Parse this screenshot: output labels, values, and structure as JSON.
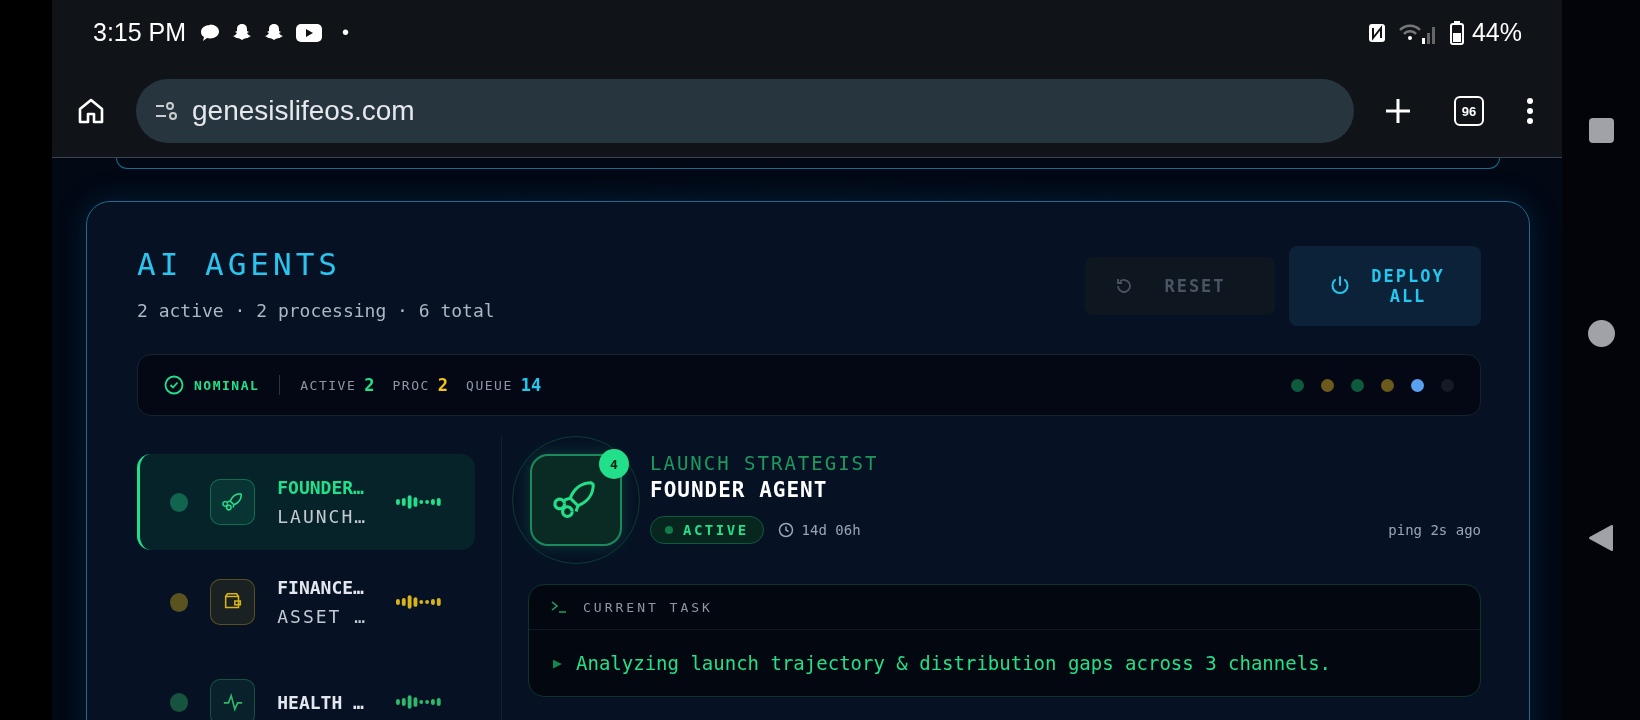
{
  "status_bar": {
    "time": "3:15 PM",
    "separator": "•",
    "battery": "44%"
  },
  "browser": {
    "url": "genesislifeos.com",
    "tab_count": "96"
  },
  "panel": {
    "title": "AI AGENTS",
    "summary": "2 active · 2 processing · 6 total",
    "buttons": [
      {
        "label": "RESET",
        "kind": "reset",
        "disabled": true
      },
      {
        "label": "DEPLOY ALL",
        "kind": "deploy"
      }
    ],
    "system": {
      "state": "NOMINAL",
      "metrics": [
        {
          "label": "ACTIVE",
          "value": "2",
          "color": "#22e08a"
        },
        {
          "label": "PROC",
          "value": "2",
          "color": "#f2c418"
        },
        {
          "label": "QUEUE",
          "value": "14",
          "color": "#22c8f0"
        }
      ],
      "dots": [
        {
          "color": "#0e5a3c"
        },
        {
          "color": "#6b5a1c"
        },
        {
          "color": "#0e5a3c"
        },
        {
          "color": "#6b5a1c"
        },
        {
          "color": "#5aa0f0"
        },
        {
          "color": "#151a26"
        }
      ]
    },
    "agents": [
      {
        "name": "FOUNDER…",
        "role": "LAUNCH…",
        "kind": "rocket",
        "color": "#22e08a",
        "selected": true
      },
      {
        "name": "FINANCE…",
        "role": "ASSET …",
        "kind": "wallet",
        "color": "#d8b418",
        "selected": false
      },
      {
        "name": "HEALTH …",
        "kind": "pulse",
        "color": "#2fb86a",
        "selected": false
      }
    ],
    "detail": {
      "badge": "4",
      "role": "LAUNCH STRATEGIST",
      "name": "FOUNDER AGENT",
      "status": "ACTIVE",
      "uptime": "14d 06h",
      "ping": "ping 2s ago",
      "task_label": "CURRENT TASK",
      "task_marker": "▶",
      "task": "Analyzing launch trajectory & distribution gaps across 3 channels."
    }
  }
}
